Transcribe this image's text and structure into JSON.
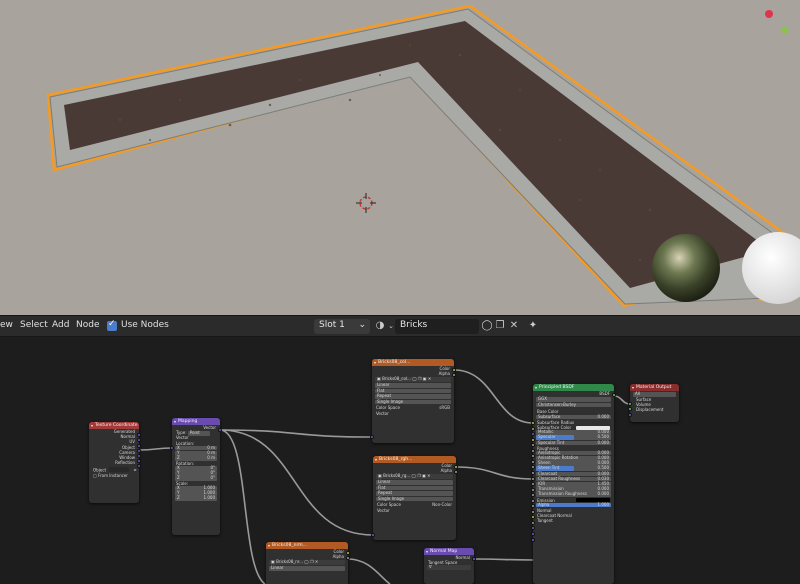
{
  "header": {
    "menus": [
      "View",
      "Select",
      "Add",
      "Node"
    ],
    "visible_menu_text": [
      "ew",
      "Select",
      "Add",
      "Node"
    ],
    "use_nodes_label": "Use Nodes",
    "use_nodes_checked": true,
    "slot_label": "Slot 1",
    "material_name": "Bricks"
  },
  "nodes": {
    "texcoord": {
      "title": "Texture Coordinate",
      "outputs": [
        "Generated",
        "Normal",
        "UV",
        "Object",
        "Camera",
        "Window",
        "Reflection"
      ],
      "object_label": "Object",
      "from_instancer": "From Instancer"
    },
    "mapping": {
      "title": "Mapping",
      "output": "Vector",
      "type_label": "Type:",
      "type_value": "Point",
      "vector_label": "Vector",
      "location_label": "Location:",
      "location": [
        [
          "X",
          "0 m"
        ],
        [
          "Y",
          "0 m"
        ],
        [
          "Z",
          "0 m"
        ]
      ],
      "rotation_label": "Rotation:",
      "rotation": [
        [
          "X",
          "0°"
        ],
        [
          "Y",
          "0°"
        ],
        [
          "Z",
          "0°"
        ]
      ],
      "scale_label": "Scale:",
      "scale": [
        [
          "X",
          "1.000"
        ],
        [
          "Y",
          "1.000"
        ],
        [
          "Z",
          "1.000"
        ]
      ]
    },
    "tex1": {
      "title": "Bricks08_col...",
      "outputs": [
        "Color",
        "Alpha"
      ],
      "image": "Bricks08_col...",
      "interp": "Linear",
      "proj": "Flat",
      "ext": "Repeat",
      "source": "Single Image",
      "cs_label": "Color Space",
      "cs_value": "sRGB",
      "vector": "Vector"
    },
    "tex2": {
      "title": "Bricks08_rgh...",
      "outputs": [
        "Color",
        "Alpha"
      ],
      "image": "Bricks08_rg...",
      "interp": "Linear",
      "proj": "Flat",
      "ext": "Repeat",
      "source": "Single Image",
      "cs_label": "Color Space",
      "cs_value": "Non-Color",
      "vector": "Vector"
    },
    "tex3": {
      "title": "Bricks08_nrm...",
      "outputs": [
        "Color",
        "Alpha"
      ],
      "image": "Bricks08_nr...",
      "interp": "Linear"
    },
    "normalmap": {
      "title": "Normal Map",
      "output": "Normal",
      "space_label": "Tangent Space"
    },
    "bsdf": {
      "title": "Principled BSDF",
      "output": "BSDF",
      "distribution": "GGX",
      "subsurface_method": "Christensen-Burley",
      "rows": [
        [
          "Base Color",
          ""
        ],
        [
          "Subsurface",
          "0.000"
        ],
        [
          "Subsurface Radius",
          ""
        ],
        [
          "Subsurface Color",
          ""
        ],
        [
          "Metallic",
          "0.000"
        ],
        [
          "Specular",
          "0.500"
        ],
        [
          "Specular Tint",
          "0.000"
        ],
        [
          "Roughness",
          ""
        ],
        [
          "Anisotropic",
          "0.000"
        ],
        [
          "Anisotropic Rotation",
          "0.000"
        ],
        [
          "Sheen",
          "0.000"
        ],
        [
          "Sheen Tint",
          "0.500"
        ],
        [
          "Clearcoat",
          "0.000"
        ],
        [
          "Clearcoat Roughness",
          "0.030"
        ],
        [
          "IOR",
          "1.450"
        ],
        [
          "Transmission",
          "0.000"
        ],
        [
          "Transmission Roughness",
          "0.000"
        ],
        [
          "Emission",
          ""
        ],
        [
          "Alpha",
          "1.000"
        ],
        [
          "Normal",
          ""
        ],
        [
          "Clearcoat Normal",
          ""
        ],
        [
          "Tangent",
          ""
        ]
      ],
      "specular_fill": 0.5,
      "sheen_tint_fill": 0.5,
      "alpha_fill": 1.0
    },
    "output": {
      "title": "Material Output",
      "target": "All",
      "inputs": [
        "Surface",
        "Volume",
        "Displacement"
      ]
    }
  },
  "colors": {
    "viewport_bg": "#a8a49d",
    "soil": "#4a3a36",
    "selection_outline": "#f59a23",
    "header_texcoord": "#a33a3a",
    "header_mapping": "#6a4bb0",
    "header_texture": "#b25a23",
    "header_normalmap": "#6a4bb0",
    "header_bsdf": "#2f8a4a",
    "header_output": "#8a2d2d",
    "accent": "#4a7ccb"
  }
}
